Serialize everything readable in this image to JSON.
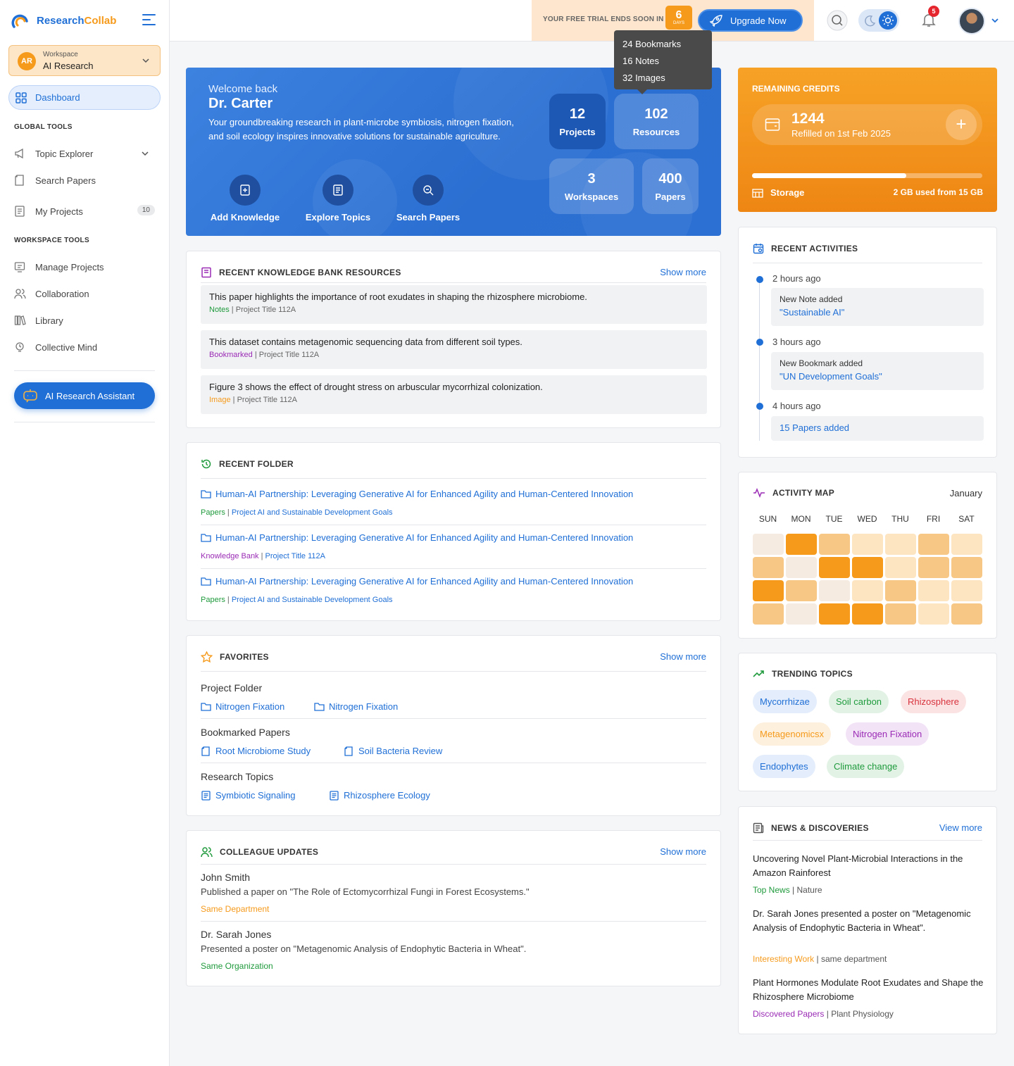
{
  "app": {
    "brand_a": "Research",
    "brand_b": "Collab"
  },
  "workspace": {
    "initials": "AR",
    "label": "Workspace",
    "name": "AI Research"
  },
  "sidebar": {
    "dashboard": "Dashboard",
    "global_title": "GLOBAL TOOLS",
    "global_items": [
      "Topic Explorer",
      "Search Papers",
      "My Projects"
    ],
    "my_projects_count": "10",
    "workspace_title": "WORKSPACE TOOLS",
    "workspace_items": [
      "Manage Projects",
      "Collaboration",
      "Library",
      "Collective  Mind"
    ],
    "ai_button": "AI Research Assistant"
  },
  "topbar": {
    "trial_text": "YOUR FREE TRIAL ENDS SOON IN",
    "days_num": "6",
    "days_label": "DAYS",
    "upgrade": "Upgrade Now",
    "notif_count": "5"
  },
  "tooltip": {
    "lines": [
      "24 Bookmarks",
      "16 Notes",
      "32 Images"
    ]
  },
  "hero": {
    "welcome": "Welcome back",
    "name": "Dr. Carter",
    "desc": "Your groundbreaking research in plant-microbe symbiosis, nitrogen fixation, and soil ecology inspires innovative solutions for sustainable agriculture.",
    "actions": [
      "Add Knowledge",
      "Explore Topics",
      "Search  Papers"
    ],
    "stats": [
      {
        "num": "12",
        "label": "Projects"
      },
      {
        "num": "102",
        "label": "Resources"
      },
      {
        "num": "3",
        "label": "Workspaces"
      },
      {
        "num": "400",
        "label": "Papers"
      }
    ]
  },
  "kb": {
    "title": "RECENT  KNOWLEDGE  BANK  RESOURCES",
    "show_more": "Show more",
    "items": [
      {
        "text": "This paper highlights the importance of root exudates in shaping the rhizosphere microbiome.",
        "tag": "Notes",
        "tag_color": "#1f9a3c",
        "project": "Project Title 112A"
      },
      {
        "text": "This dataset contains metagenomic sequencing data from different soil types.",
        "tag": "Bookmarked",
        "tag_color": "#9a2bb5",
        "project": "Project Title 112A"
      },
      {
        "text": "Figure 3 shows the effect of drought stress on arbuscular mycorrhizal colonization.",
        "tag": "Image",
        "tag_color": "#f59a1b",
        "project": "Project Title 112A"
      }
    ]
  },
  "folders": {
    "title": "RECENT FOLDER",
    "items": [
      {
        "title": "Human-AI Partnership: Leveraging Generative AI for Enhanced Agility and Human-Centered Innovation",
        "tag": "Papers",
        "tag_color": "#1f9a3c",
        "project": "Project AI and Sustainable Development Goals"
      },
      {
        "title": "Human-AI Partnership: Leveraging Generative AI for Enhanced Agility and Human-Centered Innovation",
        "tag": "Knowledge Bank",
        "tag_color": "#9a2bb5",
        "project": "Project Title 112A"
      },
      {
        "title": "Human-AI Partnership: Leveraging Generative AI for Enhanced Agility and Human-Centered Innovation",
        "tag": "Papers",
        "tag_color": "#1f9a3c",
        "project": "Project AI and Sustainable Development Goals"
      }
    ]
  },
  "favorites": {
    "title": "FAVORITES",
    "show_more": "Show more",
    "groups": [
      {
        "heading": "Project Folder",
        "links": [
          "Nitrogen Fixation",
          "Nitrogen Fixation"
        ]
      },
      {
        "heading": "Bookmarked Papers",
        "links": [
          "Root Microbiome Study",
          "Soil Bacteria Review"
        ]
      },
      {
        "heading": "Research Topics",
        "links": [
          "Symbiotic Signaling",
          "Rhizosphere Ecology"
        ]
      }
    ]
  },
  "colleagues": {
    "title": "COLLEAGUE UPDATES",
    "show_more": "Show more",
    "items": [
      {
        "name": "John Smith",
        "desc": "Published a paper on \"The Role of Ectomycorrhizal Fungi in Forest Ecosystems.\"",
        "tag": "Same Department",
        "tag_color": "#f59a1b"
      },
      {
        "name": "Dr. Sarah Jones",
        "desc": "Presented a poster on \"Metagenomic Analysis of Endophytic Bacteria in Wheat\".",
        "tag": "Same Organization",
        "tag_color": "#1f9a3c"
      }
    ]
  },
  "credits": {
    "title": "REMAINING CREDITS",
    "amount": "1244",
    "refill": "Refilled on 1st Feb 2025",
    "storage_label": "Storage",
    "storage_used": "2 GB used from 15 GB",
    "bar_fraction": 0.67
  },
  "activities": {
    "title": "RECENT ACTIVITIES",
    "items": [
      {
        "time": "2 hours ago",
        "label": "New Note added",
        "value": "\"Sustainable AI\""
      },
      {
        "time": "3 hours ago",
        "label": "New Bookmark added",
        "value": "\"UN Development Goals\""
      },
      {
        "time": "4 hours ago",
        "label": "",
        "value": "15 Papers added"
      }
    ]
  },
  "activity_map": {
    "title": "ACTIVITY MAP",
    "month": "January",
    "days": [
      "SUN",
      "MON",
      "TUE",
      "WED",
      "THU",
      "FRI",
      "SAT"
    ],
    "levels": [
      [
        0,
        4,
        2,
        1,
        1,
        2,
        1
      ],
      [
        2,
        0,
        4,
        4,
        1,
        2,
        2
      ],
      [
        4,
        2,
        0,
        1,
        2,
        1,
        1
      ],
      [
        2,
        0,
        4,
        4,
        2,
        1,
        2
      ]
    ],
    "palette": [
      "#f5ebe0",
      "#fde5c2",
      "#f7c785",
      "#f5bb6c",
      "#f59a1b"
    ]
  },
  "trending": {
    "title": "TRENDING TOPICS",
    "pills": [
      {
        "label": "Mycorrhizae",
        "fg": "#1f6fd6",
        "bg": "#e3edfb"
      },
      {
        "label": "Soil carbon",
        "fg": "#1f9a3c",
        "bg": "#e2f3e6"
      },
      {
        "label": "Rhizosphere",
        "fg": "#d8323c",
        "bg": "#fbe3e4"
      },
      {
        "label": "Metagenomicsx",
        "fg": "#f59a1b",
        "bg": "#fdf0dd"
      },
      {
        "label": "Nitrogen Fixation",
        "fg": "#9a2bb5",
        "bg": "#f3e3f7"
      },
      {
        "label": "Endophytes",
        "fg": "#1f6fd6",
        "bg": "#e3edfb"
      },
      {
        "label": "Climate change",
        "fg": "#1f9a3c",
        "bg": "#e2f3e6"
      }
    ]
  },
  "news": {
    "title": "NEWS & DISCOVERIES",
    "view_more": "View more",
    "items": [
      {
        "title": "Uncovering Novel Plant-Microbial Interactions in the Amazon Rainforest",
        "tag": "Top News",
        "tag_color": "#1f9a3c",
        "source": "Nature"
      },
      {
        "title": "Dr. Sarah Jones presented a poster on \"Metagenomic Analysis of Endophytic Bacteria in Wheat\".",
        "tag": "Interesting Work",
        "tag_color": "#f59a1b",
        "source": "same department"
      },
      {
        "title": "Plant Hormones Modulate Root Exudates and Shape the Rhizosphere Microbiome",
        "tag": "Discovered Papers",
        "tag_color": "#9a2bb5",
        "source": "Plant Physiology"
      }
    ]
  }
}
